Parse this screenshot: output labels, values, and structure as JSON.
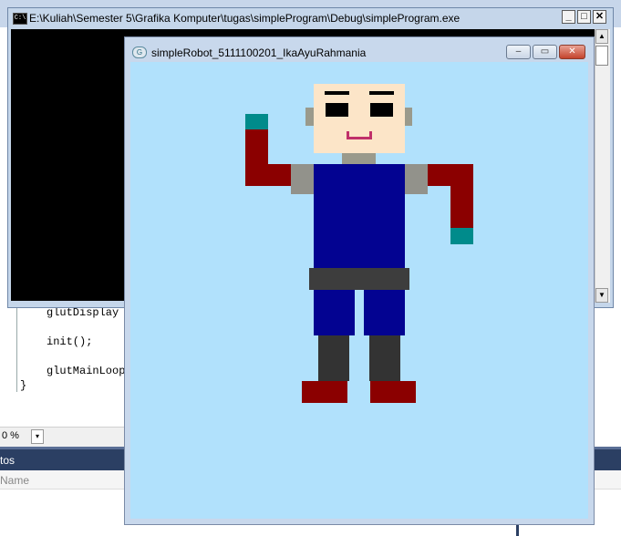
{
  "ide": {
    "code_lines": [
      "glutDisplay",
      "init();",
      "glutMainLoop",
      "}"
    ],
    "zoom_value": "0 %",
    "zoom_arrow": "▾",
    "panel_title": "tos",
    "panel_column": "Name"
  },
  "console_window": {
    "title": "E:\\Kuliah\\Semester 5\\Grafika Komputer\\tugas\\simpleProgram\\Debug\\simpleProgram.exe",
    "icon_text": "C:\\",
    "minimize": "_",
    "maximize": "□",
    "close": "✕",
    "scroll_up": "▲",
    "scroll_down": "▼"
  },
  "glut_window": {
    "title": "simpleRobot_5111100201_IkaAyuRahmania",
    "icon_text": "G",
    "minimize": "–",
    "maximize": "▭",
    "close": "✕",
    "background_color": "#b1e1fc"
  },
  "robot_colors": {
    "skin": "#fce5c8",
    "ear": "#9a9a8c",
    "eye": "#000000",
    "mouth": "#c0306a",
    "neck": "#9a9a8c",
    "torso": "#030391",
    "shoulder": "#92928b",
    "arm": "#8b0000",
    "hand": "#008b8b",
    "belt": "#3d3d3d",
    "leg": "#030391",
    "shin": "#333333",
    "foot": "#8b0000"
  }
}
